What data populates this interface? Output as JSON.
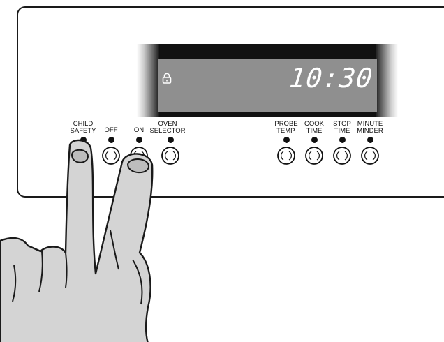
{
  "display": {
    "time": "10:30",
    "lock_icon": "lock-icon",
    "screen_color": "#8f8f8f",
    "bezel_color": "#111111"
  },
  "controls": {
    "child_safety": "CHILD\nSAFETY",
    "off": "OFF",
    "on": "ON",
    "oven_selector": "OVEN\nSELECTOR",
    "probe_temp": "PROBE\nTEMP.",
    "cook_time": "COOK\nTIME",
    "stop_time": "STOP\nTIME",
    "minute_minder": "MINUTE\nMINDER"
  },
  "illustration": {
    "hand_fill": "#d4d4d4",
    "outline": "#1a1a1a"
  }
}
